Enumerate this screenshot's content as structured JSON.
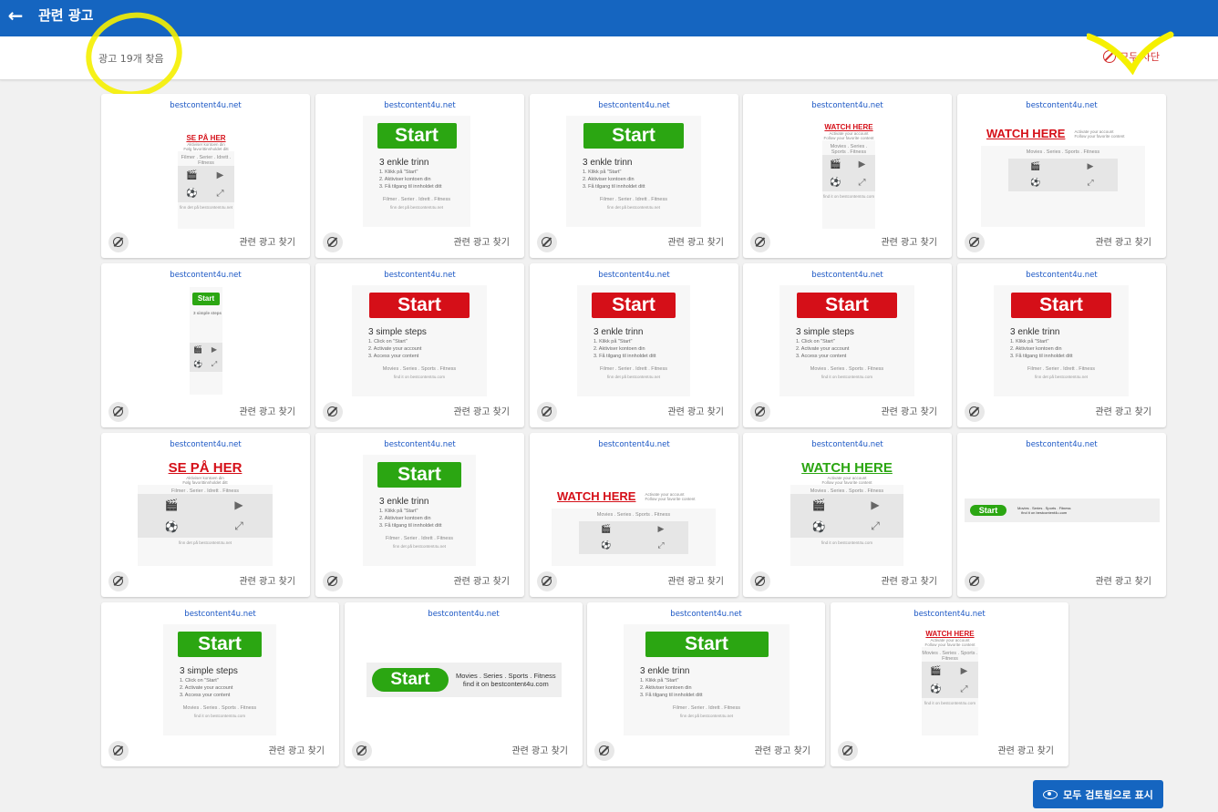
{
  "header": {
    "title": "관련 광고",
    "back_icon": "arrow-left-icon"
  },
  "summary": {
    "count_text": "광고 19개 찾음",
    "block_all_label": "모두 차단"
  },
  "card_labels": {
    "find_related": "관련 광고 찾기"
  },
  "ads": [
    {
      "domain": "bestcontent4u.net",
      "cta": "SE PÅ HER",
      "style": "watch-red-small"
    },
    {
      "domain": "bestcontent4u.net",
      "cta": "Start",
      "style": "green-steps-no"
    },
    {
      "domain": "bestcontent4u.net",
      "cta": "Start",
      "style": "green-steps-no"
    },
    {
      "domain": "bestcontent4u.net",
      "cta": "WATCH HERE",
      "style": "watch-red-small"
    },
    {
      "domain": "bestcontent4u.net",
      "cta": "WATCH HERE",
      "style": "watch-red-wide"
    },
    {
      "domain": "bestcontent4u.net",
      "cta": "Start",
      "style": "green-tall"
    },
    {
      "domain": "bestcontent4u.net",
      "cta": "Start",
      "style": "red-steps-en"
    },
    {
      "domain": "bestcontent4u.net",
      "cta": "Start",
      "style": "red-steps-no"
    },
    {
      "domain": "bestcontent4u.net",
      "cta": "Start",
      "style": "red-steps-en"
    },
    {
      "domain": "bestcontent4u.net",
      "cta": "Start",
      "style": "red-steps-no"
    },
    {
      "domain": "bestcontent4u.net",
      "cta": "SE PÅ HER",
      "style": "watch-red"
    },
    {
      "domain": "bestcontent4u.net",
      "cta": "Start",
      "style": "green-steps-no"
    },
    {
      "domain": "bestcontent4u.net",
      "cta": "WATCH HERE",
      "style": "watch-red-wide"
    },
    {
      "domain": "bestcontent4u.net",
      "cta": "WATCH HERE",
      "style": "watch-green"
    },
    {
      "domain": "bestcontent4u.net",
      "cta": "Start",
      "style": "green-banner-thin"
    },
    {
      "domain": "bestcontent4u.net",
      "cta": "Start",
      "style": "green-steps-en"
    },
    {
      "domain": "bestcontent4u.net",
      "cta": "Start",
      "style": "green-banner"
    },
    {
      "domain": "bestcontent4u.net",
      "cta": "Start",
      "style": "green-steps-no"
    },
    {
      "domain": "bestcontent4u.net",
      "cta": "WATCH HERE",
      "style": "watch-red-small"
    }
  ],
  "ad_text": {
    "steps_no": "3 enkle trinn",
    "steps_no_lines": [
      "1. Klikk på \"Start\"",
      "2. Aktiviser kontoen din",
      "3. Få tilgang til innholdet ditt"
    ],
    "menu_no": "Filmer . Serier . Idrett . Fitness",
    "foot_no": "finn det på bestcontent4u.net",
    "steps_en": "3 simple steps",
    "steps_en_lines": [
      "1. Click on \"Start\"",
      "2. Activate your account",
      "3. Access your content"
    ],
    "menu_en": "Movies . Series . Sports . Fitness",
    "foot_en": "find it on bestcontent4u.com",
    "watch_sub_en": "Activate your account",
    "watch_sub_en2": "Follow your favorite content",
    "watch_sub_no": "Aktiviser kontoen din",
    "watch_sub_no2": "Følg favorittinnholdet ditt"
  },
  "footer": {
    "show_reviewed_label": "모두 검토됨으로 표시",
    "icon": "eye-icon"
  },
  "colors": {
    "primary": "#1565c0",
    "danger": "#d32f2f",
    "link": "#1a56c4",
    "green": "#2ba612",
    "red": "#d50f18",
    "highlight": "#f5f000"
  }
}
